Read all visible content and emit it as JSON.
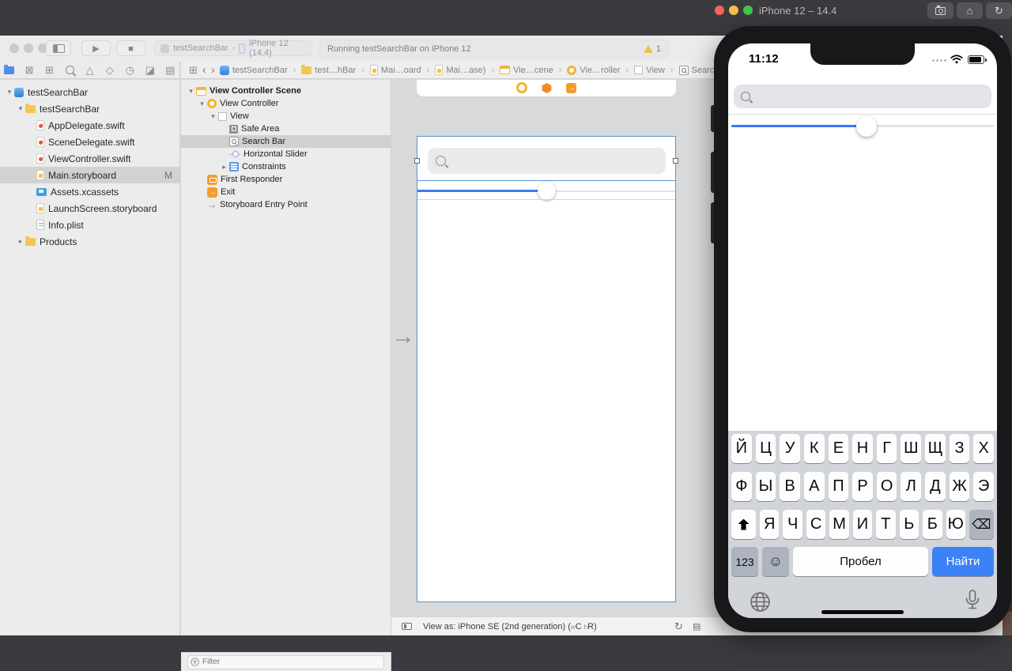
{
  "xcode": {
    "toolbar": {
      "scheme_project": "testSearchBar",
      "scheme_device": "iPhone 12 (14.4)",
      "status_message": "Running testSearchBar on iPhone 12",
      "warning_count": "1"
    },
    "navigator_tabs": [
      {
        "name": "project-navigator-tab",
        "type": "folder",
        "selected": true
      },
      {
        "name": "source-control-tab",
        "type": "source"
      },
      {
        "name": "symbol-navigator-tab",
        "type": "symbols"
      },
      {
        "name": "find-navigator-tab",
        "type": "find"
      },
      {
        "name": "issue-navigator-tab",
        "type": "issues"
      },
      {
        "name": "test-navigator-tab",
        "type": "tests"
      },
      {
        "name": "debug-navigator-tab",
        "type": "debug"
      },
      {
        "name": "breakpoint-navigator-tab",
        "type": "break"
      },
      {
        "name": "report-navigator-tab",
        "type": "report"
      }
    ],
    "file_tree": [
      {
        "label": "testSearchBar",
        "icon": "project",
        "level": 0,
        "disclosure": "open"
      },
      {
        "label": "testSearchBar",
        "icon": "folder",
        "level": 1,
        "disclosure": "open"
      },
      {
        "label": "AppDelegate.swift",
        "icon": "swift",
        "level": 2
      },
      {
        "label": "SceneDelegate.swift",
        "icon": "swift",
        "level": 2
      },
      {
        "label": "ViewController.swift",
        "icon": "swift",
        "level": 2
      },
      {
        "label": "Main.storyboard",
        "icon": "storyboard",
        "level": 2,
        "selected": true,
        "badge": "M"
      },
      {
        "label": "Assets.xcassets",
        "icon": "assets",
        "level": 2
      },
      {
        "label": "LaunchScreen.storyboard",
        "icon": "storyboard",
        "level": 2
      },
      {
        "label": "Info.plist",
        "icon": "plist",
        "level": 2
      },
      {
        "label": "Products",
        "icon": "folder",
        "level": 1,
        "disclosure": "closed"
      }
    ],
    "jump_bar": [
      {
        "label": "testSearchBar",
        "icon": "project"
      },
      {
        "label": "test…hBar",
        "icon": "folder"
      },
      {
        "label": "Mai…oard",
        "icon": "storyboard"
      },
      {
        "label": "Mai…ase)",
        "icon": "storyboard"
      },
      {
        "label": "Vie…cene",
        "icon": "scene"
      },
      {
        "label": "Vie…roller",
        "icon": "vc"
      },
      {
        "label": "View",
        "icon": "view"
      },
      {
        "label": "Search Bar",
        "icon": "sbar"
      }
    ],
    "outline_tree": [
      {
        "label": "View Controller Scene",
        "icon": "scene",
        "level": 0,
        "disclosure": "open",
        "bold": true
      },
      {
        "label": "View Controller",
        "icon": "vc",
        "level": 1,
        "disclosure": "open"
      },
      {
        "label": "View",
        "icon": "view",
        "level": 2,
        "disclosure": "open"
      },
      {
        "label": "Safe Area",
        "icon": "safearea",
        "level": 3
      },
      {
        "label": "Search Bar",
        "icon": "sbar",
        "level": 3,
        "selected": true
      },
      {
        "label": "Horizontal Slider",
        "icon": "slider",
        "level": 3
      },
      {
        "label": "Constraints",
        "icon": "constraints",
        "level": 3,
        "disclosure": "closed"
      },
      {
        "label": "First Responder",
        "icon": "firstresponder",
        "level": 1
      },
      {
        "label": "Exit",
        "icon": "exit",
        "level": 1
      },
      {
        "label": "Storyboard Entry Point",
        "icon": "entrypoint",
        "level": 1
      }
    ],
    "outline_filter_placeholder": "Filter",
    "canvas_bottombar": {
      "view_as_prefix": "View as: iPhone SE (2nd generation) (",
      "trait_w": "w",
      "trait_c": "C",
      "trait_h": "h",
      "trait_r": "R",
      "suffix": ")"
    }
  },
  "simulator": {
    "title": "iPhone 12 – 14.4",
    "status_time": "11:12",
    "keyboard": {
      "row1": [
        "Й",
        "Ц",
        "У",
        "К",
        "Е",
        "Н",
        "Г",
        "Ш",
        "Щ",
        "З",
        "Х"
      ],
      "row2": [
        "Ф",
        "Ы",
        "В",
        "А",
        "П",
        "Р",
        "О",
        "Л",
        "Д",
        "Ж",
        "Э"
      ],
      "row3": [
        "Я",
        "Ч",
        "С",
        "М",
        "И",
        "Т",
        "Ь",
        "Б",
        "Ю"
      ],
      "backspace_glyph": "⌫",
      "key_123": "123",
      "emoji_glyph": "☺",
      "space": "Пробел",
      "return": "Найти"
    },
    "colors": {
      "slider_blue": "#3478f6",
      "return_key_blue": "#3b82f7",
      "keyboard_bg": "#d1d4d9",
      "selection_blue": "#5796d1"
    }
  }
}
